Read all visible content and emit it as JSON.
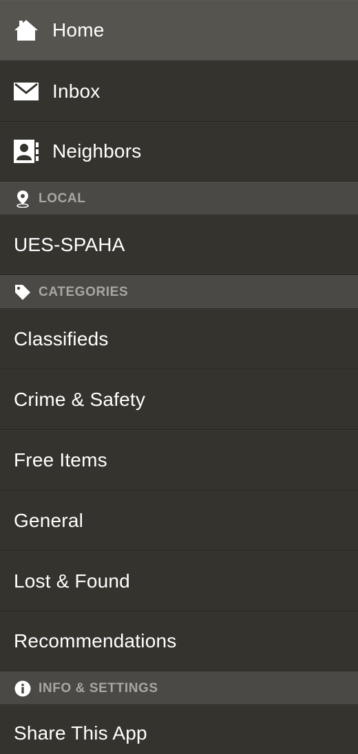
{
  "menu": {
    "main": [
      {
        "label": "Home",
        "icon": "home-icon"
      },
      {
        "label": "Inbox",
        "icon": "envelope-icon"
      },
      {
        "label": "Neighbors",
        "icon": "contact-card-icon"
      }
    ],
    "local": {
      "header": "LOCAL",
      "icon": "location-pin-icon",
      "items": [
        {
          "label": "UES-SPAHA"
        }
      ]
    },
    "categories": {
      "header": "CATEGORIES",
      "icon": "tag-icon",
      "items": [
        {
          "label": "Classifieds"
        },
        {
          "label": "Crime & Safety"
        },
        {
          "label": "Free Items"
        },
        {
          "label": "General"
        },
        {
          "label": "Lost & Found"
        },
        {
          "label": "Recommendations"
        }
      ]
    },
    "info": {
      "header": "INFO & SETTINGS",
      "icon": "info-icon",
      "items": [
        {
          "label": "Share This App"
        }
      ]
    }
  },
  "colors": {
    "row_background": "#35332e",
    "active_row_background": "#56544f",
    "section_background": "#4b4945",
    "section_text": "#a9a7a2",
    "text": "#ffffff"
  }
}
